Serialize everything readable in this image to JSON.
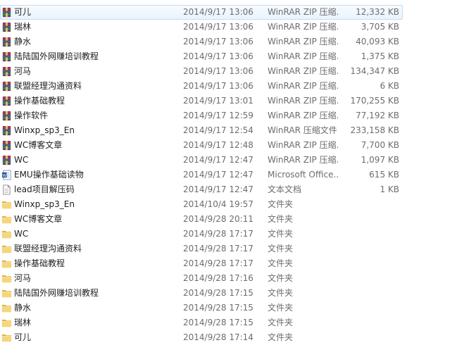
{
  "rows": [
    {
      "name": "可儿",
      "date": "2014/9/17 13:06",
      "type": "WinRAR ZIP 压缩...",
      "size": "12,332 KB",
      "icon": "winrar-archive-icon",
      "selected": true
    },
    {
      "name": "瑞林",
      "date": "2014/9/17 13:06",
      "type": "WinRAR ZIP 压缩...",
      "size": "3,705 KB",
      "icon": "winrar-archive-icon"
    },
    {
      "name": "静水",
      "date": "2014/9/17 13:06",
      "type": "WinRAR ZIP 压缩...",
      "size": "40,093 KB",
      "icon": "winrar-archive-icon"
    },
    {
      "name": "陆陆国外网赚培训教程",
      "date": "2014/9/17 13:06",
      "type": "WinRAR ZIP 压缩...",
      "size": "1,375 KB",
      "icon": "winrar-archive-icon"
    },
    {
      "name": "河马",
      "date": "2014/9/17 13:06",
      "type": "WinRAR ZIP 压缩...",
      "size": "134,347 KB",
      "icon": "winrar-archive-icon"
    },
    {
      "name": "联盟经理沟通资料",
      "date": "2014/9/17 13:06",
      "type": "WinRAR ZIP 压缩...",
      "size": "6 KB",
      "icon": "winrar-archive-icon"
    },
    {
      "name": "操作基础教程",
      "date": "2014/9/17 13:01",
      "type": "WinRAR ZIP 压缩...",
      "size": "170,255 KB",
      "icon": "winrar-archive-icon"
    },
    {
      "name": "操作软件",
      "date": "2014/9/17 12:59",
      "type": "WinRAR ZIP 压缩...",
      "size": "77,192 KB",
      "icon": "winrar-archive-icon"
    },
    {
      "name": "Winxp_sp3_En",
      "date": "2014/9/17 12:54",
      "type": "WinRAR 压缩文件",
      "size": "233,158 KB",
      "icon": "winrar-archive-icon"
    },
    {
      "name": "WC博客文章",
      "date": "2014/9/17 12:48",
      "type": "WinRAR ZIP 压缩...",
      "size": "7,700 KB",
      "icon": "winrar-archive-icon"
    },
    {
      "name": "WC",
      "date": "2014/9/17 12:47",
      "type": "WinRAR ZIP 压缩...",
      "size": "1,097 KB",
      "icon": "winrar-archive-icon"
    },
    {
      "name": "EMU操作基础读物",
      "date": "2014/9/17 12:47",
      "type": "Microsoft Office...",
      "size": "615 KB",
      "icon": "word-document-icon"
    },
    {
      "name": "lead项目解压码",
      "date": "2014/9/17 12:47",
      "type": "文本文档",
      "size": "1 KB",
      "icon": "text-document-icon"
    },
    {
      "name": "Winxp_sp3_En",
      "date": "2014/10/4 19:57",
      "type": "文件夹",
      "size": "",
      "icon": "folder-icon"
    },
    {
      "name": "WC博客文章",
      "date": "2014/9/28 20:11",
      "type": "文件夹",
      "size": "",
      "icon": "folder-icon"
    },
    {
      "name": "WC",
      "date": "2014/9/28 17:17",
      "type": "文件夹",
      "size": "",
      "icon": "folder-icon"
    },
    {
      "name": "联盟经理沟通资料",
      "date": "2014/9/28 17:17",
      "type": "文件夹",
      "size": "",
      "icon": "folder-icon"
    },
    {
      "name": "操作基础教程",
      "date": "2014/9/28 17:17",
      "type": "文件夹",
      "size": "",
      "icon": "folder-icon"
    },
    {
      "name": "河马",
      "date": "2014/9/28 17:16",
      "type": "文件夹",
      "size": "",
      "icon": "folder-icon"
    },
    {
      "name": "陆陆国外网赚培训教程",
      "date": "2014/9/28 17:15",
      "type": "文件夹",
      "size": "",
      "icon": "folder-icon"
    },
    {
      "name": "静水",
      "date": "2014/9/28 17:15",
      "type": "文件夹",
      "size": "",
      "icon": "folder-icon"
    },
    {
      "name": "瑞林",
      "date": "2014/9/28 17:15",
      "type": "文件夹",
      "size": "",
      "icon": "folder-icon"
    },
    {
      "name": "可儿",
      "date": "2014/9/28 17:14",
      "type": "文件夹",
      "size": "",
      "icon": "folder-icon"
    }
  ]
}
